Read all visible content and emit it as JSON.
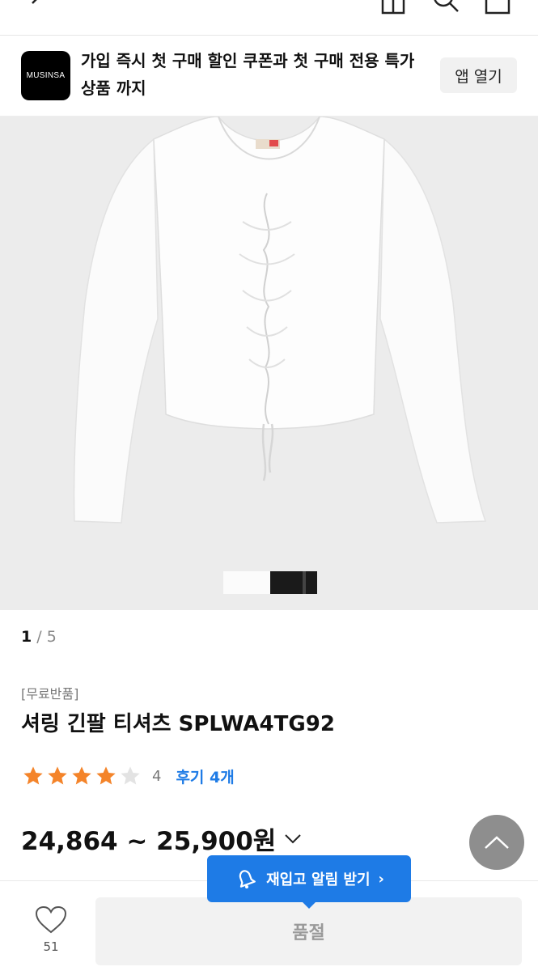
{
  "banner": {
    "logo_text": "MUSINSA",
    "message": "가입 즉시 첫 구매 할인 쿠폰과 첫 구매 전용 특가 상품 까지",
    "open_app_label": "앱 열기"
  },
  "gallery": {
    "current": "1",
    "separator": "/",
    "total": "5"
  },
  "product": {
    "tag": "[무료반품]",
    "name": "셔링 긴팔 티셔츠 SPLWA4TG92",
    "rating": 4,
    "rating_max": 5,
    "rating_text": "4",
    "reviews_label": "후기 4개",
    "price": "24,864 ~ 25,900원"
  },
  "restock": {
    "label": "재입고 알림 받기",
    "chevron": "›"
  },
  "bottom": {
    "like_count": "51",
    "soldout_label": "품절"
  },
  "colors": {
    "accent": "#1e7be6",
    "star": "#f4842a",
    "star_empty": "#e3e3e3"
  }
}
